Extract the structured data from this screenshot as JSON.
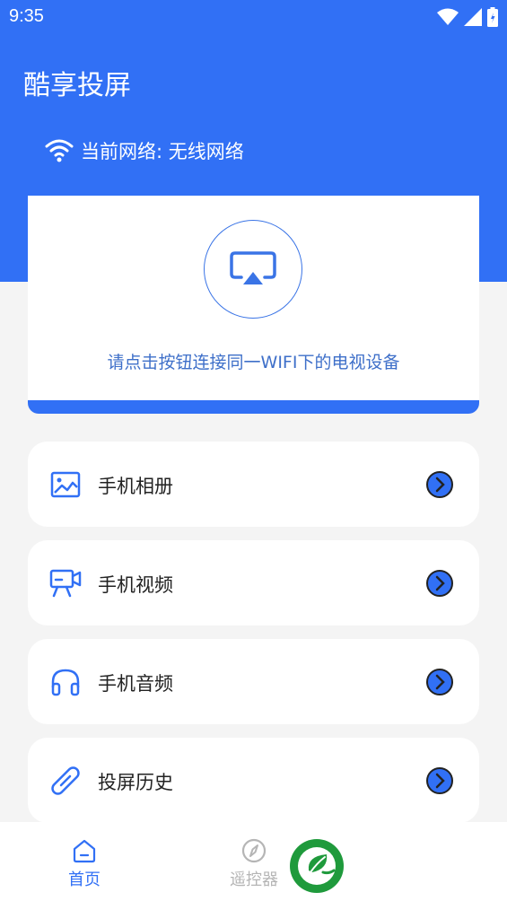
{
  "status_bar": {
    "time": "9:35"
  },
  "header": {
    "title": "酷享投屏",
    "network_label": "当前网络: 无线网络"
  },
  "cast": {
    "hint": "请点击按钮连接同一WIFI下的电视设备"
  },
  "menu": [
    {
      "label": "手机相册",
      "icon": "photo-album-icon"
    },
    {
      "label": "手机视频",
      "icon": "video-camera-icon"
    },
    {
      "label": "手机音频",
      "icon": "headphones-icon"
    },
    {
      "label": "投屏历史",
      "icon": "link-icon"
    }
  ],
  "tabbar": {
    "home_label": "首页",
    "remote_label": "遥控器"
  },
  "colors": {
    "primary": "#3170f5",
    "hint": "#3e6fc9",
    "inactive": "#b5b5b5",
    "logo_green": "#1f9a3c"
  }
}
